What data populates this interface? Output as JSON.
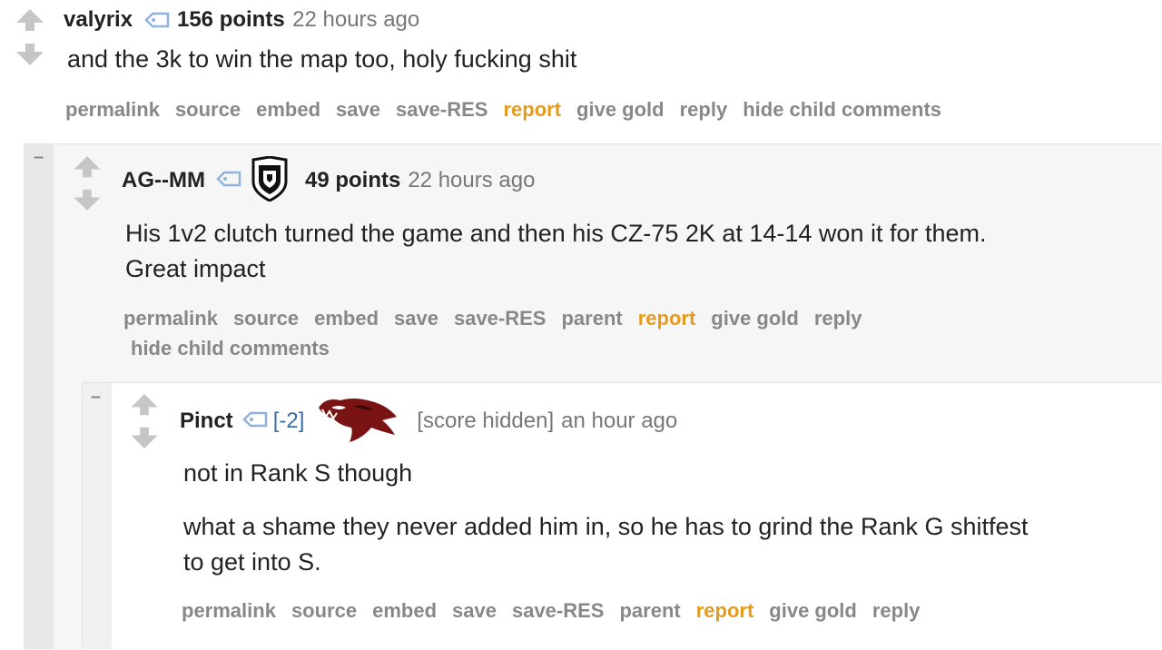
{
  "comments": [
    {
      "author": "valyrix",
      "score": "156 points",
      "time": "22 hours ago",
      "body": [
        "and the 3k to win the map too, holy fucking shit"
      ],
      "actions": [
        "permalink",
        "source",
        "embed",
        "save",
        "save-RES",
        "report",
        "give gold",
        "reply",
        "hide child comments"
      ]
    },
    {
      "collapse": "–",
      "author": "AG--MM",
      "score": "49 points",
      "time": "22 hours ago",
      "flair_icon": "team-shield-icon",
      "body": [
        "His 1v2 clutch turned the game and then his CZ-75 2K at 14-14 won it for them.",
        "Great impact"
      ],
      "actions": [
        "permalink",
        "source",
        "embed",
        "save",
        "save-RES",
        "parent",
        "report",
        "give gold",
        "reply"
      ],
      "actions_line2": [
        "hide child comments"
      ]
    },
    {
      "collapse": "–",
      "author": "Pinct",
      "karma_tag": "[-2]",
      "flair_icon": "team-panther-icon",
      "score": "[score hidden]",
      "time": "an hour ago",
      "body": [
        "not in Rank S though",
        "what a shame they never added him in, so he has to grind the Rank G shitfest",
        "to get into S."
      ],
      "actions": [
        "permalink",
        "source",
        "embed",
        "save",
        "save-RES",
        "parent",
        "report",
        "give gold",
        "reply"
      ]
    }
  ],
  "colors": {
    "report": "#e39b20",
    "action": "#888888",
    "tag": "#8fb3d9",
    "karma": "#3b6ea8"
  }
}
